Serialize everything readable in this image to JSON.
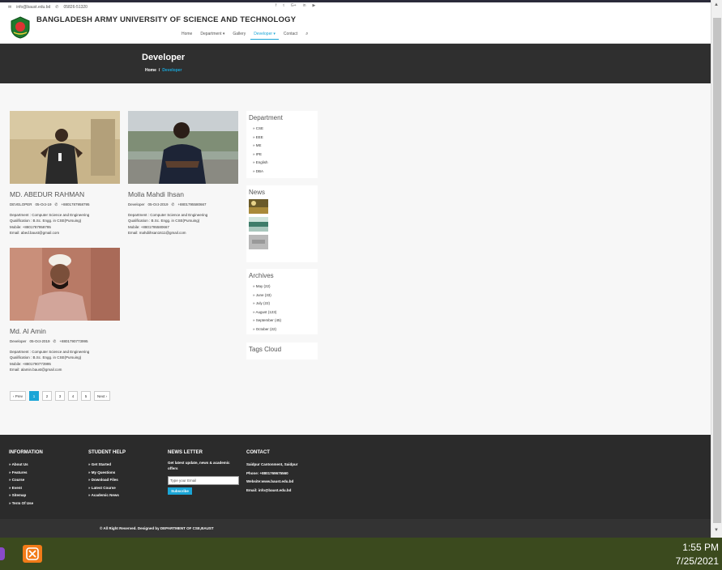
{
  "topbar": {
    "email": "info@baust.edu.bd",
    "phone": "05826-51320",
    "social_icons": [
      "facebook-icon",
      "twitter-icon",
      "googleplus-icon",
      "linkedin-icon",
      "youtube-icon"
    ]
  },
  "header": {
    "site_title": "BANGLADESH ARMY UNIVERSITY OF SCIENCE AND TECHNOLOGY",
    "nav": [
      "Home",
      "Department",
      "Gallery",
      "Developer",
      "Contact"
    ],
    "active_nav": "Developer"
  },
  "page": {
    "title": "Developer",
    "breadcrumb_home": "Home",
    "breadcrumb_sep": "/",
    "breadcrumb_current": "Developer"
  },
  "developers": [
    {
      "name": "MD. ABEDUR RAHMAN",
      "role": "DEVELOPER",
      "date": "05-Oct-19",
      "phone": "+8801787958795",
      "department": "Department : Computer Science and Engineering",
      "qualification": "Qualification : B.Sc. Engg. in CSE(Pursuing)",
      "mobile": "Mobile: +8801787958795",
      "email": "Email: abed.baust@gmail.com"
    },
    {
      "name": "Molla Mahdi Ihsan",
      "role": "Developer",
      "date": "05-Oct-2019",
      "phone": "+8801795580667",
      "department": "Department : Computer Science and Engineering",
      "qualification": "Qualification : B.Sc. Engg. in CSE(Pursuing)",
      "mobile": "Mobile: +8801795580667",
      "email": "Email: mahdiihsan1611@gmail.com"
    },
    {
      "name": "Md. Al Amin",
      "role": "Developer",
      "date": "05-Oct-2019",
      "phone": "+8801790773995",
      "department": "Department : Computer Science and Engineering",
      "qualification": "Qualification : B.Sc. Engg. in CSE(Pursuing)",
      "mobile": "Mobile: +8801790773995",
      "email": "Email: alamin.baust@gmail.com"
    }
  ],
  "pagination": {
    "prev": "‹ Prev",
    "pages": [
      "1",
      "2",
      "3",
      "4",
      "5"
    ],
    "current": "1",
    "next": "Next ›"
  },
  "sidebar": {
    "department": {
      "title": "Department",
      "items": [
        "CSE",
        "EEE",
        "ME",
        "IPE",
        "English",
        "DBA"
      ]
    },
    "news": {
      "title": "News"
    },
    "archives": {
      "title": "Archives",
      "items": [
        "May (22)",
        "June (33)",
        "July (22)",
        "August (123)",
        "September (45)",
        "October (22)"
      ]
    },
    "tags": {
      "title": "Tags Cloud"
    }
  },
  "footer": {
    "information": {
      "title": "INFORMATION",
      "items": [
        "About Us",
        "Features",
        "Course",
        "Event",
        "Sitemap",
        "Term Of Use"
      ]
    },
    "student_help": {
      "title": "STUDENT HELP",
      "items": [
        "Get Started",
        "My Questions",
        "Download Files",
        "Latest Course",
        "Academic News"
      ]
    },
    "newsletter": {
      "title": "NEWS LETTER",
      "text": "Get latest update, news & academic offers",
      "placeholder": "Type your Email",
      "button": "Subscribe"
    },
    "contact": {
      "title": "CONTACT",
      "address": "Saidpur Cantonment, Saidpur",
      "phone": "Phone: +8801769675560",
      "website": "Website:www.baust.edu.bd",
      "email": "Email: info@baust.edu.bd"
    },
    "copyright": "© All Right Reserved. Designed by DEPARTMENT OF CSE,BAUST"
  },
  "taskbar": {
    "time": "1:55 PM",
    "date": "7/25/2021"
  },
  "colors": {
    "accent": "#1aa5d6",
    "dark_band": "#2f2f2f",
    "footer": "#2b2b2b",
    "taskbar": "#3b4a1e",
    "xampp": "#f27b18"
  }
}
